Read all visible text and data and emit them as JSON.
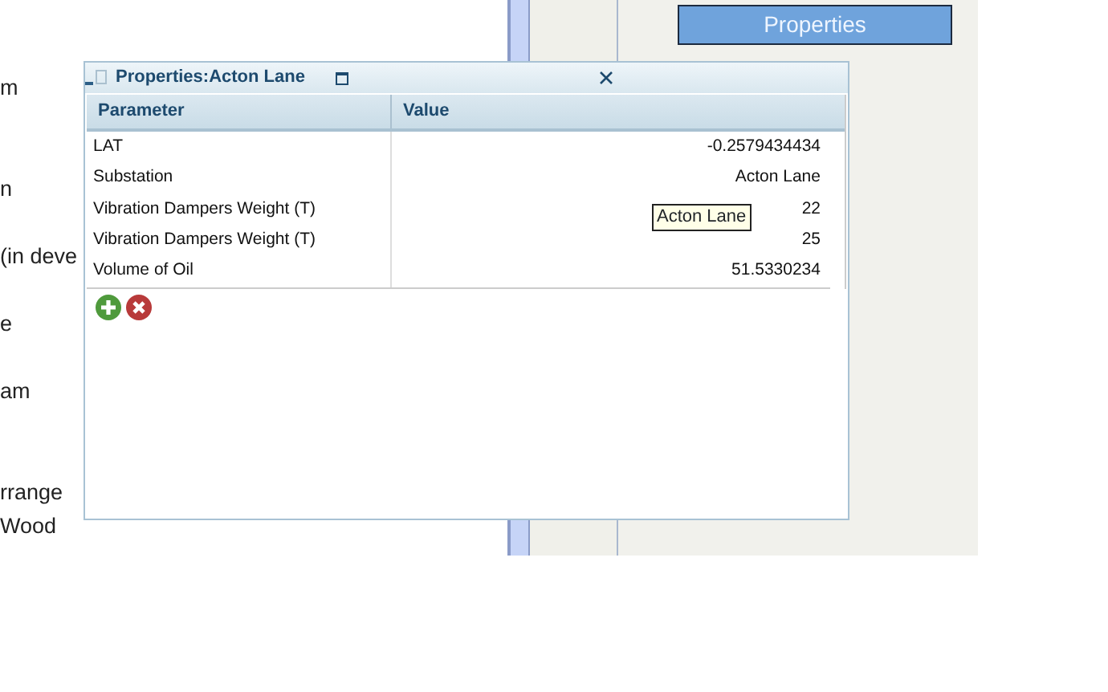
{
  "background_text": [
    "m",
    "n",
    "(in deve",
    "e",
    "am",
    "rrange",
    "Wood"
  ],
  "properties_button": {
    "label": "Properties"
  },
  "dialog": {
    "title": "Properties:Acton Lane",
    "columns": [
      "Parameter",
      "Value"
    ],
    "rows": [
      {
        "parameter": "LAT",
        "value": "-0.2579434434"
      },
      {
        "parameter": "Substation",
        "value": "Acton Lane"
      },
      {
        "parameter": "Vibration Dampers Weight (T)",
        "value": "22"
      },
      {
        "parameter": "Vibration Dampers Weight (T)",
        "value": "25"
      },
      {
        "parameter": "Volume of Oil",
        "value": "51.5330234"
      }
    ],
    "tooltip": "Acton Lane"
  }
}
